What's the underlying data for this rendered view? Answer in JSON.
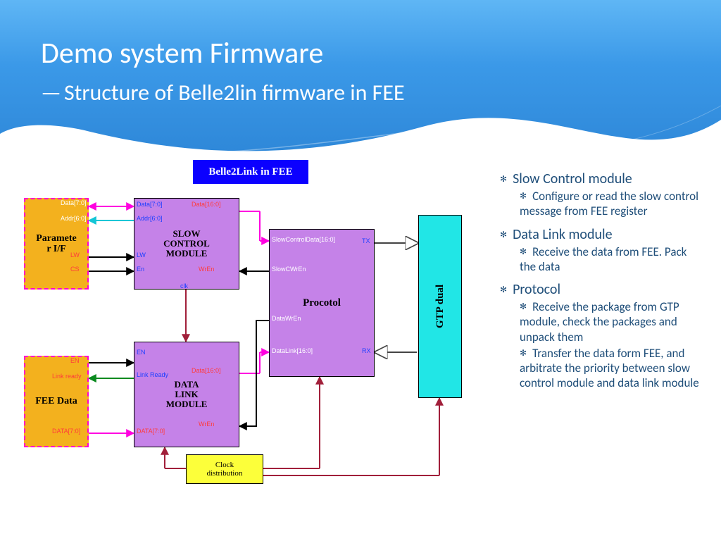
{
  "title": "Demo system Firmware",
  "subtitle": "Structure of Belle2lin firmware in FEE",
  "bullets": {
    "a_head": "Slow Control module",
    "a1": "Configure or read the slow control message from FEE register",
    "b_head": "Data Link module",
    "b1": "Receive the data from FEE. Pack  the data",
    "c_head": "Protocol",
    "c1": "Receive the package from GTP module, check the packages and  unpack them",
    "c2": "Transfer the data form FEE, and arbitrate the priority between slow control module and data link module"
  },
  "diagram": {
    "banner": "Belle2Link in FEE",
    "param_if": "Paramete\nr I/F",
    "fee_data": "FEE Data",
    "slow_ctrl": "SLOW\nCONTROL\nMODULE",
    "data_link": "DATA\nLINK\nMODULE",
    "protocol": "Procotol",
    "gtp": "GTP dual",
    "clock": "Clock\ndistribution"
  },
  "ports": {
    "pif_data": "Data[7:0]",
    "pif_addr": "Addr[6:0]",
    "pif_lw": "LW",
    "pif_cs": "CS",
    "scm_data": "Data[7:0]",
    "scm_addr": "Addr[6:0]",
    "scm_data16": "Data[16:0]",
    "scm_lw": "LW",
    "scm_en": "En",
    "scm_wren": "WrEn",
    "scm_clk": "clk",
    "fee_en": "EN",
    "fee_lr": "Link ready",
    "fee_data70": "DATA[7:0]",
    "dlm_en": "EN",
    "dlm_lr": "Link Ready",
    "dlm_data16": "Data[16:0]",
    "dlm_data70": "DATA[7:0]",
    "dlm_wren": "WrEn",
    "proto_scd": "SlowControlData[16:0]",
    "proto_scw": "SlowCWrEn",
    "proto_dw": "DataWrEn",
    "proto_dl": "DataLink[16:0]",
    "proto_tx": "TX",
    "proto_rx": "RX"
  }
}
